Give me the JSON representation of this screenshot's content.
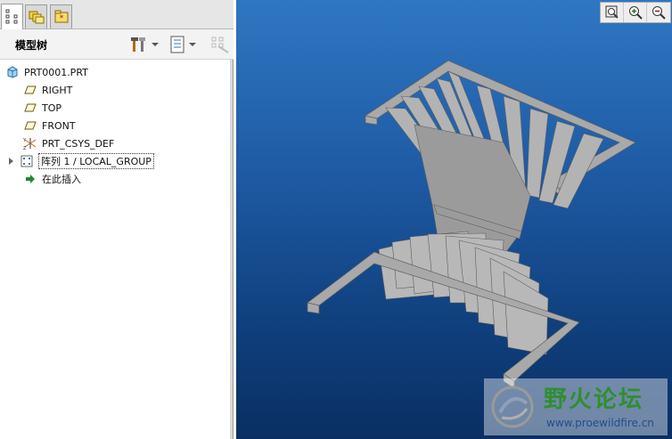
{
  "tabs": [
    {
      "icon": "model-tree-icon"
    },
    {
      "icon": "folder-browser-icon"
    },
    {
      "icon": "favorites-icon"
    }
  ],
  "tree_header": {
    "title": "模型树",
    "buttons": [
      "settings-icon",
      "show-icon",
      "disabled-tool-icon"
    ]
  },
  "tree": {
    "root": {
      "label": "PRT0001.PRT",
      "icon": "part-icon"
    },
    "items": [
      {
        "label": "RIGHT",
        "icon": "datum-plane-icon"
      },
      {
        "label": "TOP",
        "icon": "datum-plane-icon"
      },
      {
        "label": "FRONT",
        "icon": "datum-plane-icon"
      },
      {
        "label": "PRT_CSYS_DEF",
        "icon": "coordinate-system-icon"
      },
      {
        "label": "阵列 1 / LOCAL_GROUP",
        "icon": "pattern-icon",
        "collapsed": true
      },
      {
        "label": "在此插入",
        "icon": "insert-here-arrow-icon"
      }
    ]
  },
  "viewport": {
    "toolbar": [
      "zoom-fit-icon",
      "zoom-in-icon",
      "zoom-out-icon"
    ],
    "background_top": "#2f77c2",
    "background_bottom": "#0a2f63",
    "model_color": "#a9a9a9"
  },
  "watermark": {
    "title": "野火论坛",
    "url": "www.proewildfire.cn"
  }
}
